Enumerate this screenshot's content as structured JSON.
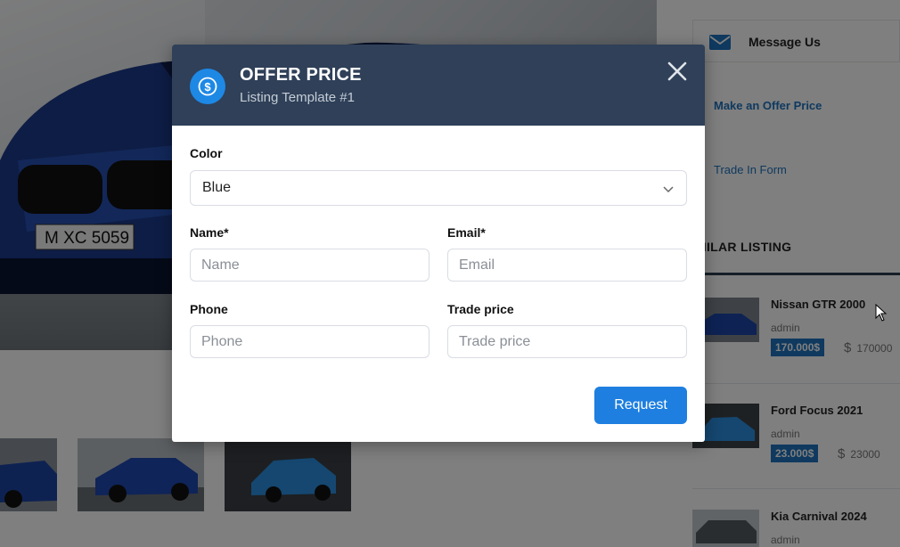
{
  "sidebar": {
    "message_label": "Message Us",
    "offer_link": "Make an Offer Price",
    "trade_link": "Trade In Form",
    "similar_title": "MILAR LISTING",
    "listings": [
      {
        "title": "Nissan GTR 2000",
        "author": "admin",
        "price": "170.000$",
        "old_price": "170000",
        "currency": "$"
      },
      {
        "title": "Ford Focus 2021",
        "author": "admin",
        "price": "23.000$",
        "old_price": "23000",
        "currency": "$"
      },
      {
        "title": "Kia Carnival 2024",
        "author": "admin"
      }
    ]
  },
  "hero": {
    "plate": "M XC 5059"
  },
  "modal": {
    "title": "OFFER PRICE",
    "subtitle": "Listing Template #1",
    "color_label": "Color",
    "color_value": "Blue",
    "name_label": "Name*",
    "name_placeholder": "Name",
    "email_label": "Email*",
    "email_placeholder": "Email",
    "phone_label": "Phone",
    "phone_placeholder": "Phone",
    "trade_label": "Trade price",
    "trade_placeholder": "Trade price",
    "request_label": "Request",
    "icon": "dollar-coin-icon"
  },
  "colors": {
    "accent": "#1e7fe0",
    "header": "#2f4058",
    "price_badge": "#1e73be"
  }
}
